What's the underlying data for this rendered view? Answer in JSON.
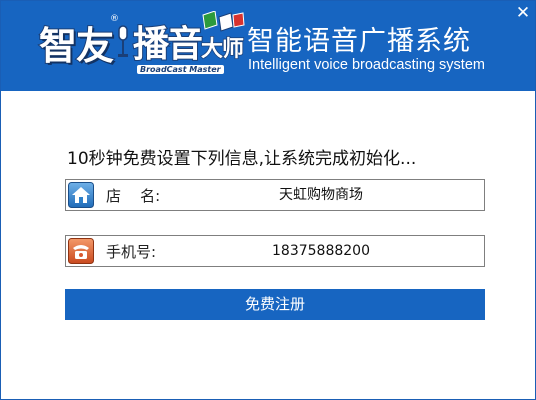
{
  "window": {
    "close_glyph": "✕",
    "close_icon": "close-icon"
  },
  "logo": {
    "main": "智友",
    "registered": "®",
    "broadcast_big": "播音",
    "broadcast_small": "大师",
    "tagline": "BroadCast Master"
  },
  "header": {
    "title_cn": "智能语音广播系统",
    "title_en": "Intelligent voice broadcasting system"
  },
  "form": {
    "prompt": "10秒钟免费设置下列信息,让系统完成初始化...",
    "shop": {
      "icon": "home-icon",
      "label": "店    名:",
      "value": "天虹购物商场"
    },
    "phone": {
      "icon": "telephone-icon",
      "label": "手机号:",
      "value": "18375888200"
    },
    "register_label": "免费注册"
  },
  "colors": {
    "header_bg": "#1765c1",
    "button_bg": "#1765c1",
    "home_icon_bg": "#2f7fc8",
    "phone_icon_bg": "#d9582f"
  }
}
